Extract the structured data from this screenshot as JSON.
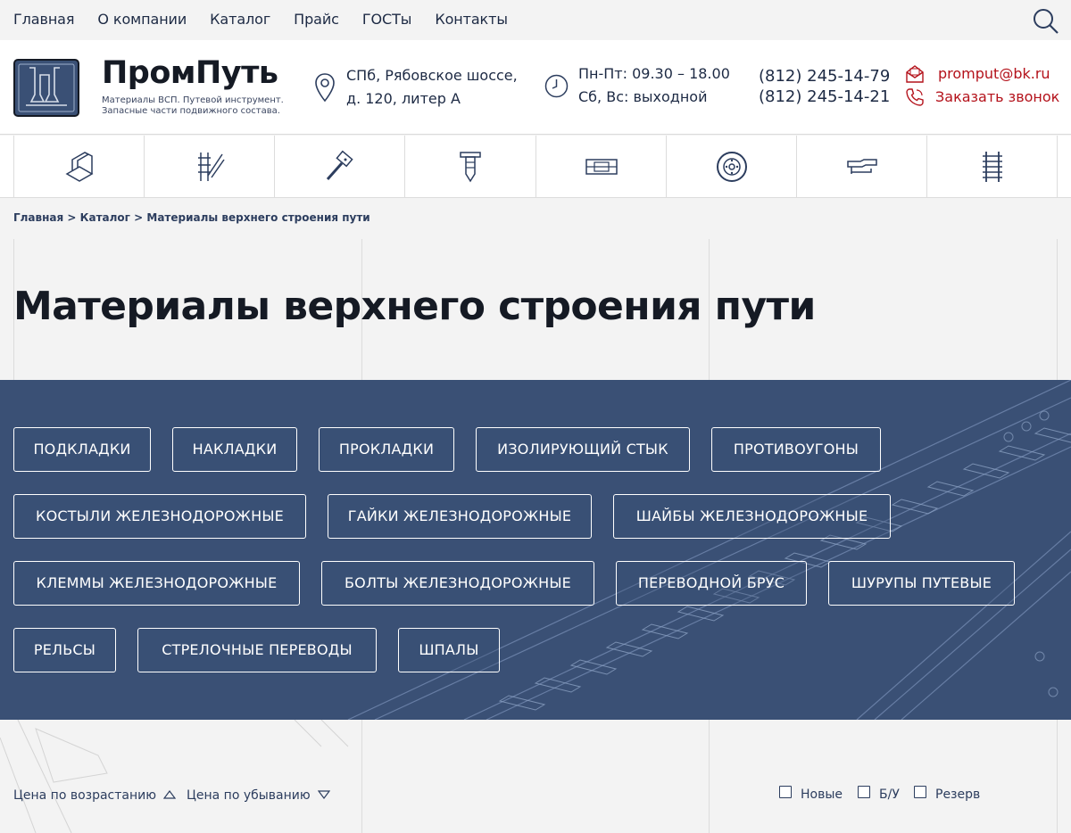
{
  "topnav": {
    "items": [
      "Главная",
      "О компании",
      "Каталог",
      "Прайс",
      "ГОСТы",
      "Контакты"
    ]
  },
  "header": {
    "brand": "ПромПуть",
    "tagline_1": "Материалы ВСП. Путевой инструмент.",
    "tagline_2": "Запасные части подвижного состава.",
    "address_1": "СПб, Рябовское шоссе,",
    "address_2": "д. 120, литер А",
    "hours_1": "Пн-Пт: 09.30 – 18.00",
    "hours_2": "Сб, Вс: выходной",
    "phone_1": "(812) 245-14-79",
    "phone_2": "(812) 245-14-21",
    "email": "promput@bk.ru",
    "callback": "Заказать звонок"
  },
  "category_icons": [
    "rail-profile-icon",
    "rail-ladder-icon",
    "sledgehammer-icon",
    "rail-spike-icon",
    "switch-plate-icon",
    "wheel-icon",
    "coupling-icon",
    "sleepers-icon"
  ],
  "breadcrumb": {
    "home": "Главная",
    "sep": ">",
    "catalog": "Каталог",
    "current": "Материалы верхнего строения пути"
  },
  "page_title": "Материалы верхнего строения пути",
  "tags": [
    "ПОДКЛАДКИ",
    "НАКЛАДКИ",
    "ПРОКЛАДКИ",
    "ИЗОЛИРУЮЩИЙ СТЫК",
    "ПРОТИВОУГОНЫ",
    "КОСТЫЛИ ЖЕЛЕЗНОДОРОЖНЫЕ",
    "ГАЙКИ ЖЕЛЕЗНОДОРОЖНЫЕ",
    "ШАЙБЫ ЖЕЛЕЗНОДОРОЖНЫЕ",
    "КЛЕММЫ ЖЕЛЕЗНОДОРОЖНЫЕ",
    "БОЛТЫ ЖЕЛЕЗНОДОРОЖНЫЕ",
    "ПЕРЕВОДНОЙ БРУС",
    "ШУРУПЫ ПУТЕВЫЕ",
    "РЕЛЬСЫ",
    "СТРЕЛОЧНЫЕ ПЕРЕВОДЫ",
    "ШПАЛЫ"
  ],
  "sort": {
    "asc": "Цена по возрастанию",
    "desc": "Цена по убыванию"
  },
  "filters": {
    "new": "Новые",
    "used": "Б/У",
    "reserve": "Резерв"
  },
  "colors": {
    "accent_red": "#b4121b",
    "band_blue": "#3a5075",
    "text_dark": "#1d2a44"
  }
}
